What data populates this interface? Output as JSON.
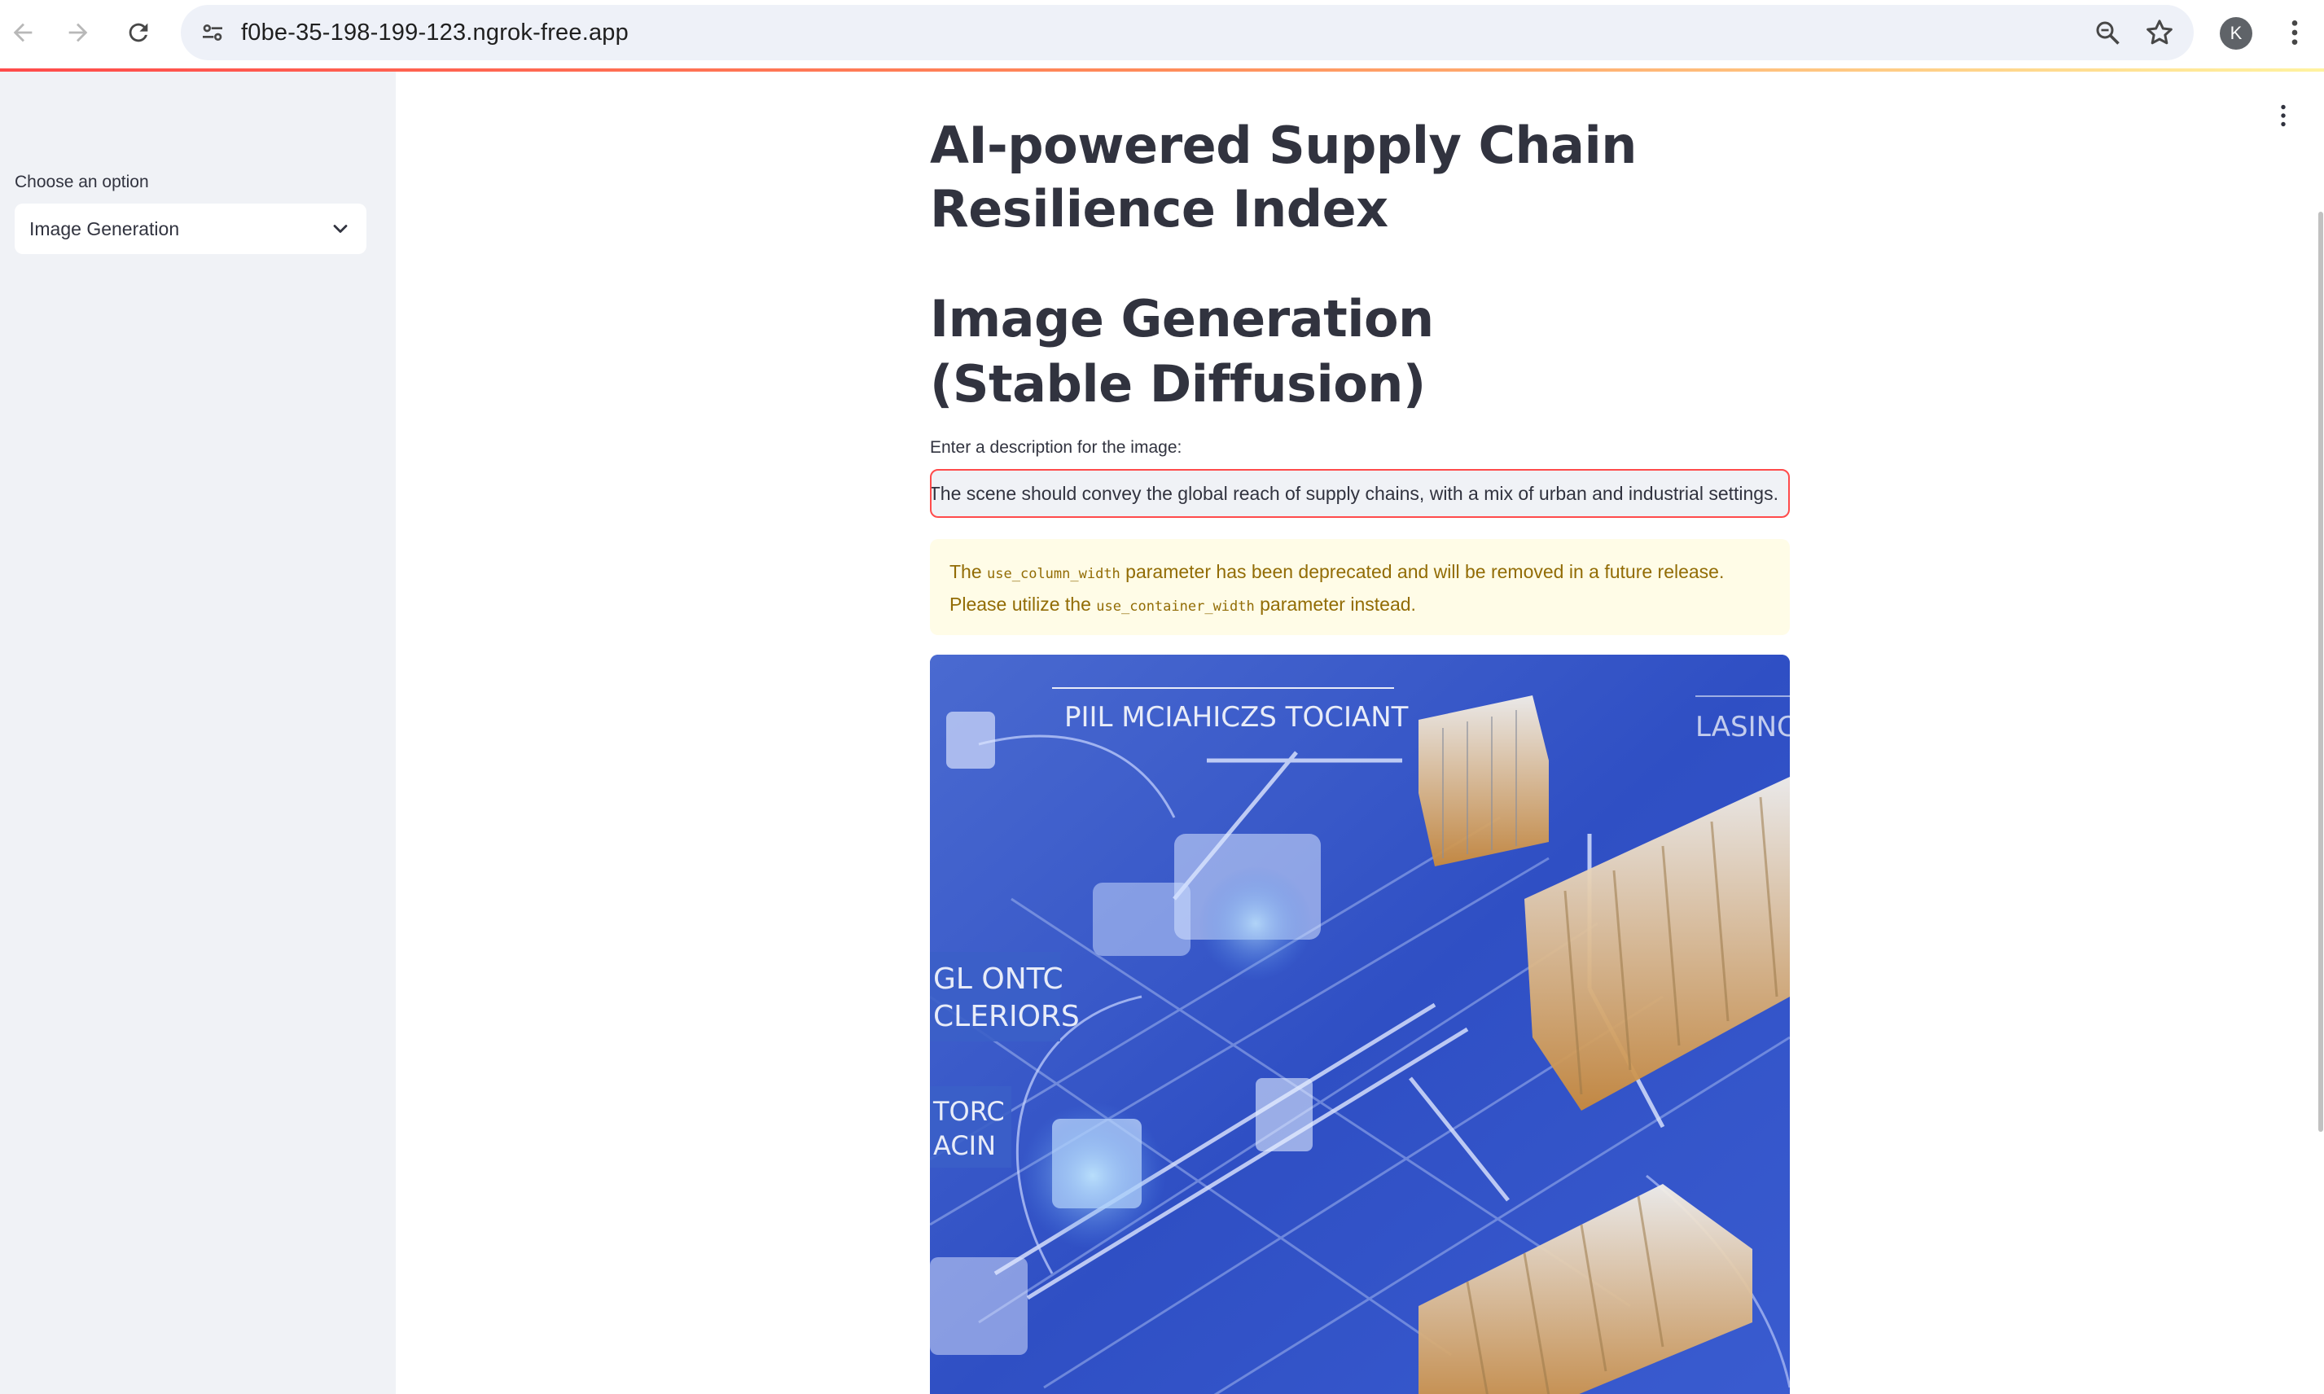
{
  "browser": {
    "url": "f0be-35-198-199-123.ngrok-free.app",
    "profile_initial": "K"
  },
  "sidebar": {
    "select_label": "Choose an option",
    "select_value": "Image Generation"
  },
  "main": {
    "title": "AI-powered Supply Chain Resilience Index",
    "subheader": "Image Generation (Stable Diffusion)",
    "input_label": "Enter a description for the image:",
    "input_value": "s. The scene should convey the global reach of supply chains, with a mix of urban and industrial settings.",
    "warning": {
      "part1": "The ",
      "code1": "use_column_width",
      "part2": " parameter has been deprecated and will be removed in a future release. Please utilize the ",
      "code2": "use_container_width",
      "part3": " parameter instead."
    },
    "image_text": {
      "top_banner": "PIIL MCIAHICZS TOCIANT",
      "top_right": "LASINC",
      "left_sign_1": "GL ONTC",
      "left_sign_2": "CLERIORS",
      "left_sign_3": "TORC",
      "left_sign_4": "ACIN"
    }
  },
  "colors": {
    "accent": "#ff4b4b",
    "sidebar_bg": "#f0f2f6",
    "warning_bg": "#fffce7",
    "warning_text": "#926c05",
    "image_base": "#3555c4"
  }
}
